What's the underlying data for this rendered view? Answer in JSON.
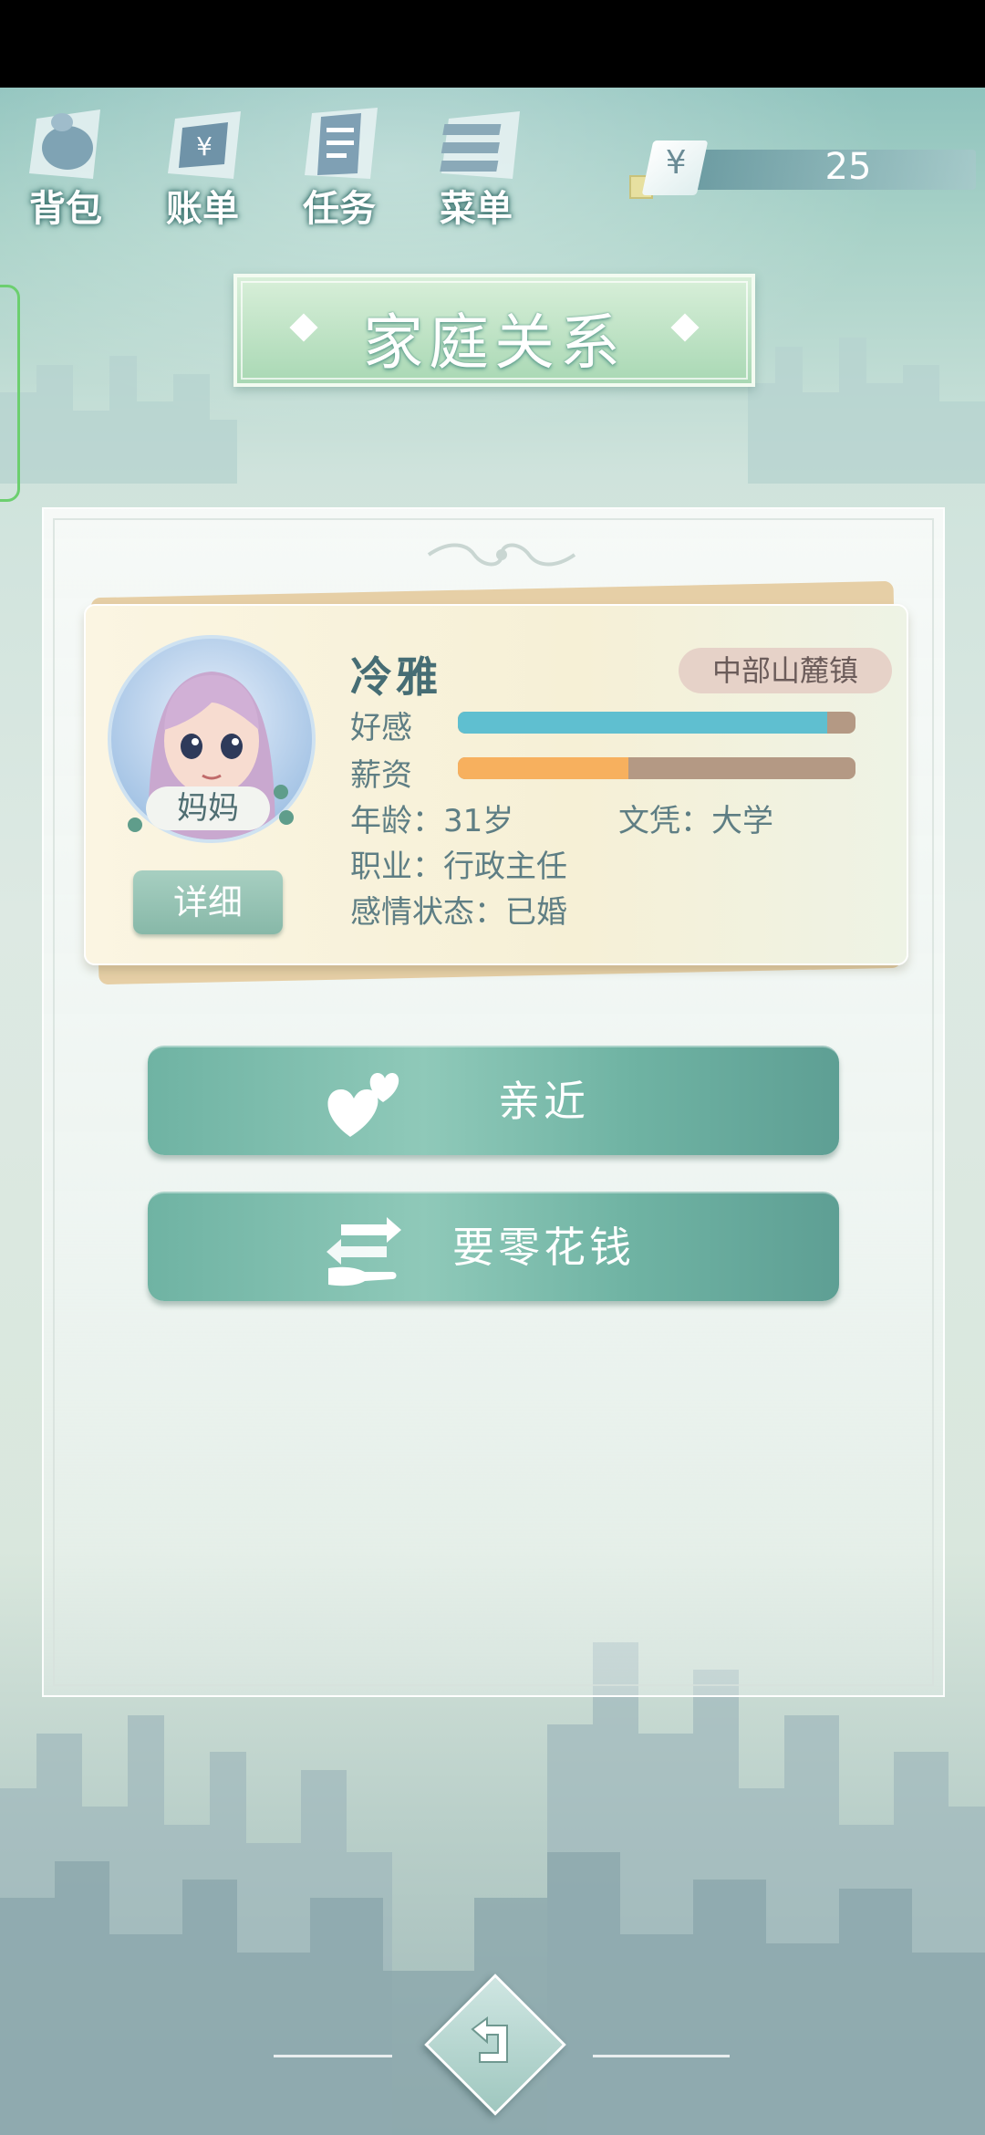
{
  "top_nav": {
    "items": [
      {
        "label": "背包",
        "icon": "bag-icon"
      },
      {
        "label": "账单",
        "icon": "bill-icon"
      },
      {
        "label": "任务",
        "icon": "task-icon"
      },
      {
        "label": "菜单",
        "icon": "menu-icon"
      }
    ],
    "currency_symbol": "¥",
    "money": "25"
  },
  "page_title": "家庭关系",
  "character": {
    "relation": "妈妈",
    "name": "冷雅",
    "location": "中部山麓镇",
    "favor_label": "好感",
    "favor_fraction": 0.93,
    "salary_label": "薪资",
    "salary_fraction": 0.43,
    "age": "年龄：31岁",
    "education": "文凭：大学",
    "occupation": "职业：行政主任",
    "relationship_status": "感情状态：已婚",
    "detail_button": "详细"
  },
  "actions": [
    {
      "label": "亲近",
      "icon": "hearts-icon"
    },
    {
      "label": "要零花钱",
      "icon": "hand-money-icon"
    }
  ],
  "colors": {
    "favor_bar": "#5fbfd0",
    "salary_bar": "#f7b05e",
    "bar_track": "#b49984",
    "accent": "#6fb3a3"
  }
}
